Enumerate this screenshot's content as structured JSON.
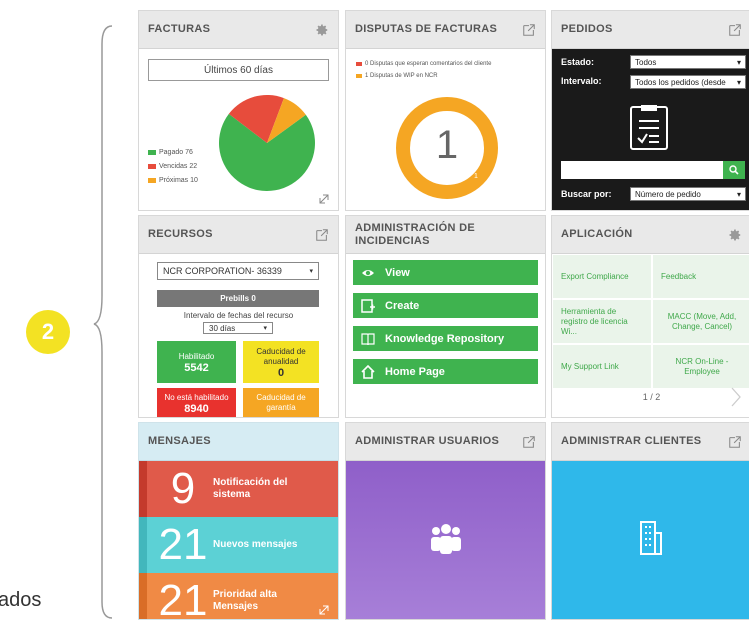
{
  "side": {
    "badge": "2",
    "clipped_text": "ados"
  },
  "colors": {
    "green": "#3fb34f",
    "red": "#e74c3c",
    "orange": "#f5a623",
    "yellow": "#f3e223"
  },
  "facturas": {
    "title": "FACTURAS",
    "range": "Últimos 60 días",
    "legend": [
      "Pagado 76",
      "Vencidas 22",
      "Próximas 10"
    ],
    "pie": [
      {
        "label": "Pagado",
        "value": 76,
        "color": "#3fb34f"
      },
      {
        "label": "Vencidas",
        "value": 22,
        "color": "#e74c3c"
      },
      {
        "label": "Próximas",
        "value": 10,
        "color": "#f5a623"
      }
    ]
  },
  "disputas": {
    "title": "DISPUTAS DE FACTURAS",
    "legend": [
      "0 Disputas que esperan comentarios del cliente",
      "1 Disputas de WIP en NCR"
    ],
    "center_value": "1",
    "ring_label": "1"
  },
  "pedidos": {
    "title": "PEDIDOS",
    "estado_label": "Estado:",
    "estado_value": "Todos",
    "intervalo_label": "Intervalo:",
    "intervalo_value": "Todos los pedidos (desde",
    "buscar_label": "Buscar por:",
    "buscar_value": "Número de pedido",
    "search_placeholder": ""
  },
  "recursos": {
    "title": "RECURSOS",
    "company": "NCR CORPORATION- 36339",
    "prebills": "Prebills 0",
    "interval_label": "Intervalo de fechas del recurso",
    "interval_value": "30 días",
    "cells": [
      {
        "label": "Habilitado",
        "value": "5542"
      },
      {
        "label": "Caducidad de anualidad",
        "value": "0"
      },
      {
        "label": "No está habilitado",
        "value": "8940"
      },
      {
        "label": "Caducidad de garantía",
        "value": ""
      }
    ]
  },
  "incidencias": {
    "title": "ADMINISTRACIÓN DE INCIDENCIAS",
    "buttons": [
      "View",
      "Create",
      "Knowledge Repository",
      "Home Page"
    ]
  },
  "aplicacion": {
    "title": "APLICACIÓN",
    "items": [
      "Export Compliance",
      "Feedback",
      "Herramienta de registro de licencia Wi...",
      "MACC (Move, Add, Change, Cancel)",
      "My Support Link",
      "NCR On-Line - Employee"
    ],
    "pager": "1 / 2"
  },
  "mensajes": {
    "title": "MENSAJES",
    "rows": [
      {
        "count": "9",
        "label": "Notificación del sistema"
      },
      {
        "count": "21",
        "label": "Nuevos mensajes"
      },
      {
        "count": "21",
        "label": "Prioridad alta Mensajes"
      }
    ]
  },
  "usuarios": {
    "title": "ADMINISTRAR USUARIOS"
  },
  "clientes": {
    "title": "ADMINISTRAR CLIENTES"
  }
}
